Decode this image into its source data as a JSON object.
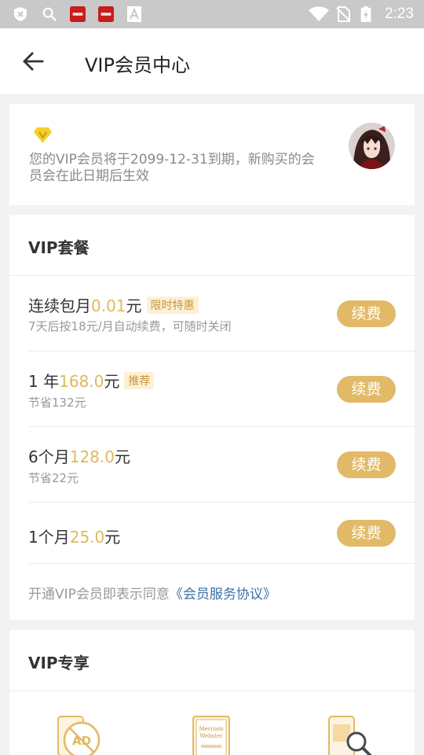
{
  "status_bar": {
    "time": "2:23",
    "left_icons": [
      "shield-icon",
      "search-icon",
      "app-icon-red",
      "app-icon-red-2",
      "text-app-icon"
    ],
    "right_icons": [
      "wifi-icon",
      "no-sim-icon",
      "battery-charging-icon"
    ]
  },
  "header": {
    "title": "VIP会员中心"
  },
  "member": {
    "expiry_text": "您的VIP会员将于2099-12-31到期，新购买的会员会在此日期后生效"
  },
  "packages": {
    "title": "VIP套餐",
    "items": [
      {
        "prefix": "连续包月",
        "price": "0.01",
        "unit": "元",
        "tag": "限时特惠",
        "sub": "7天后按18元/月自动续费，可随时关闭",
        "button": "续费"
      },
      {
        "prefix": "1 年",
        "price": "168.0",
        "unit": "元",
        "tag": "推荐",
        "sub": "节省132元",
        "button": "续费"
      },
      {
        "prefix": "6个月",
        "price": "128.0",
        "unit": "元",
        "tag": "",
        "sub": "节省22元",
        "button": "续费"
      },
      {
        "prefix": "1个月",
        "price": "25.0",
        "unit": "元",
        "tag": "",
        "sub": "",
        "button": "续费"
      }
    ],
    "agreement_prefix": "开通VIP会员即表示同意",
    "agreement_link": "《会员服务协议》"
  },
  "exclusive": {
    "title": "VIP专享",
    "icons": [
      "no-ads-icon",
      "dictionary-book-icon",
      "phone-search-icon"
    ],
    "book_text_1": "Merriam",
    "book_text_2": "Webster",
    "ad_text": "AD"
  },
  "colors": {
    "accent": "#e2b966",
    "price": "#e0b85e",
    "link": "#3a6fa8"
  }
}
